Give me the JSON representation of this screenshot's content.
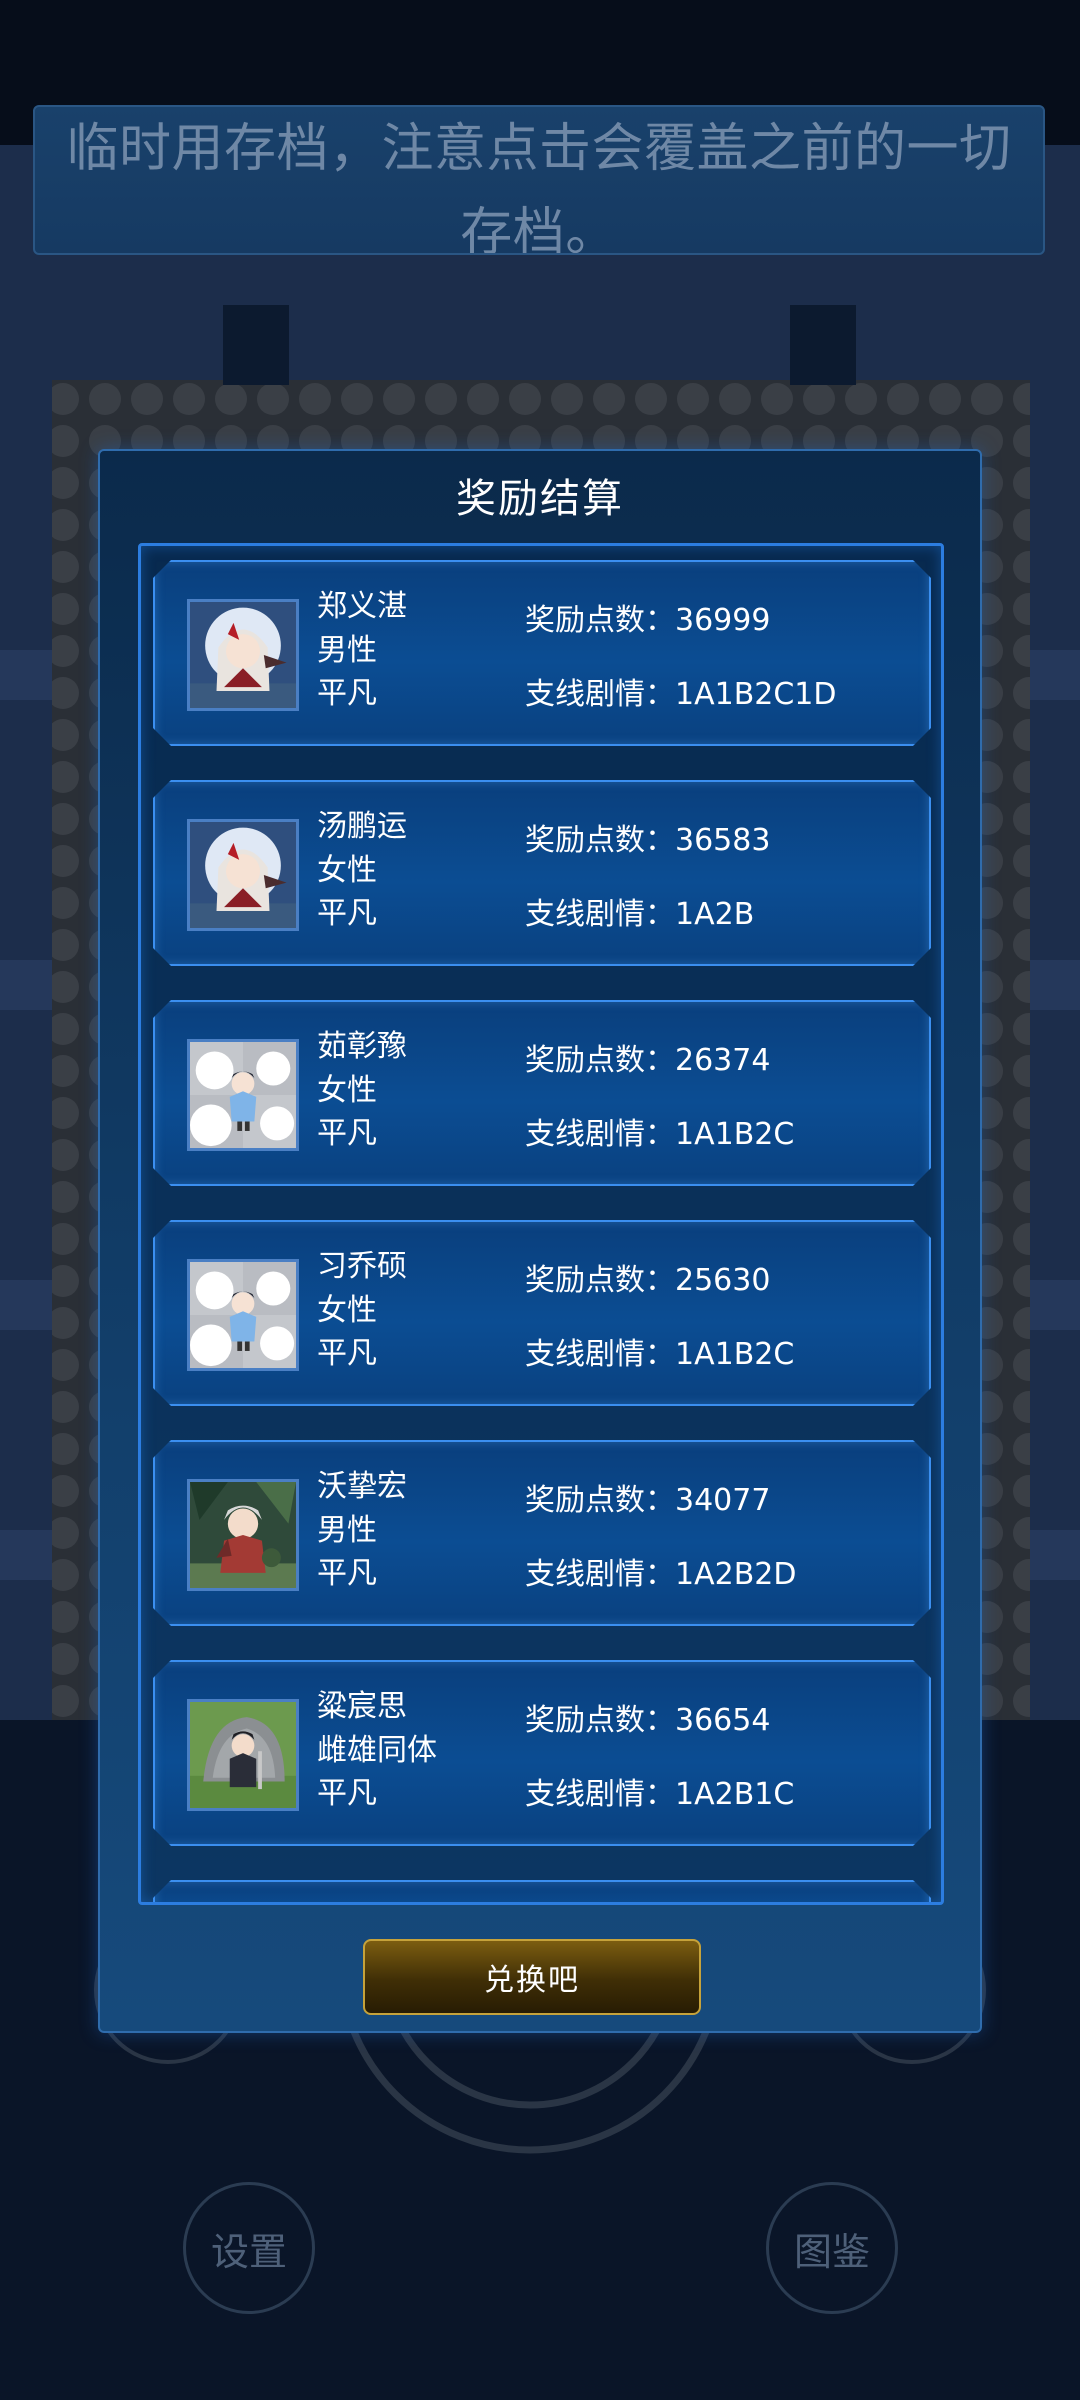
{
  "notice_text": "临时用存档，注意点击会覆盖之前的一切\n存档。",
  "modal": {
    "title": "奖励结算",
    "exchange_label": "兑换吧"
  },
  "labels": {
    "points_prefix": "奖励点数：",
    "story_prefix": "支线剧情："
  },
  "characters": [
    {
      "name": "郑义湛",
      "gender": "男性",
      "talent": "平凡",
      "points": "36999",
      "story": "1A1B2C1D",
      "avatar_icon": "anime-girl-moon-avatar-icon"
    },
    {
      "name": "汤鹏运",
      "gender": "女性",
      "talent": "平凡",
      "points": "36583",
      "story": "1A2B",
      "avatar_icon": "anime-girl-moon-avatar-icon"
    },
    {
      "name": "茹彰豫",
      "gender": "女性",
      "talent": "平凡",
      "points": "26374",
      "story": "1A1B2C",
      "avatar_icon": "chibi-cloud-swordsman-avatar-icon"
    },
    {
      "name": "习乔硕",
      "gender": "女性",
      "talent": "平凡",
      "points": "25630",
      "story": "1A1B2C",
      "avatar_icon": "chibi-cloud-swordsman-avatar-icon"
    },
    {
      "name": "沃挚宏",
      "gender": "男性",
      "talent": "平凡",
      "points": "34077",
      "story": "1A2B2D",
      "avatar_icon": "forest-warrior-avatar-icon"
    },
    {
      "name": "粱宸思",
      "gender": "雌雄同体",
      "talent": "平凡",
      "points": "36654",
      "story": "1A2B1C",
      "avatar_icon": "rock-swordsman-avatar-icon"
    }
  ],
  "bottom_buttons": {
    "settings": "设置",
    "codex": "图鉴"
  },
  "colors": {
    "accent_blue": "#3b8ff0",
    "button_gold": "#c6a23a"
  }
}
